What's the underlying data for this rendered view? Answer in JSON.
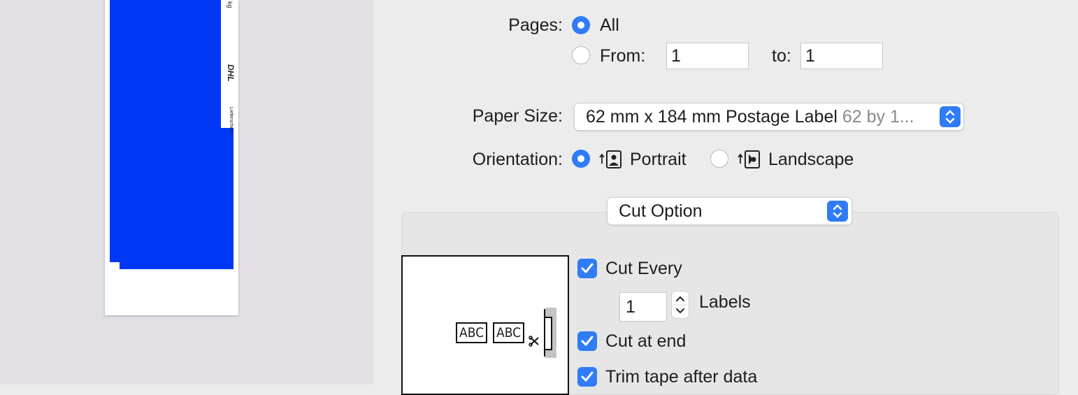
{
  "preview": {
    "strip_text_kg": "kg",
    "strip_logo": "DHL",
    "strip_small": "Lieferschein",
    "accent_color": "#0037f5"
  },
  "pages": {
    "label": "Pages:",
    "all_label": "All",
    "from_label": "From:",
    "from_value": "1",
    "to_label": "to:",
    "to_value": "1",
    "selected": "All"
  },
  "paper_size": {
    "label": "Paper Size:",
    "value": "62 mm x 184 mm Postage Label",
    "detail": "62 by 1..."
  },
  "orientation": {
    "label": "Orientation:",
    "portrait_label": "Portrait",
    "landscape_label": "Landscape",
    "selected": "Portrait"
  },
  "section_popup": {
    "value": "Cut Option"
  },
  "cut_options": {
    "diagram_labels": [
      "ABC",
      "ABC"
    ],
    "cut_every_label": "Cut Every",
    "cut_every_checked": true,
    "count_value": "1",
    "count_unit": "Labels",
    "cut_at_end_label": "Cut at end",
    "cut_at_end_checked": true,
    "trim_tape_label": "Trim tape after data",
    "trim_tape_checked": true
  },
  "colors": {
    "accent": "#2f7cf6",
    "panel_bg": "#ececec",
    "preview_bg": "#e2e0e4"
  }
}
